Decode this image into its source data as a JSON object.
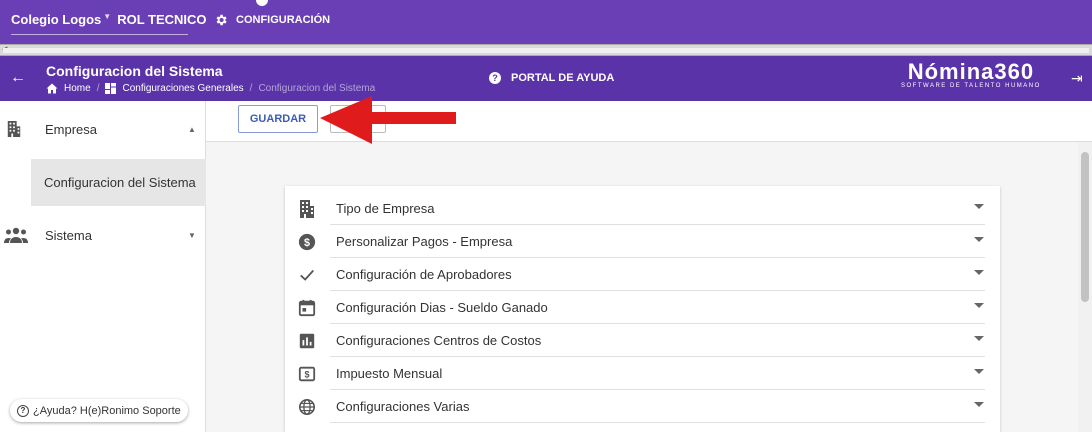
{
  "topbar": {
    "org_name": "Colegio Logos",
    "role": "ROL TECNICO",
    "config_label": "CONFIGURACIÓN"
  },
  "header": {
    "title": "Configuracion del Sistema",
    "breadcrumbs": [
      "Home",
      "Configuraciones Generales",
      "Configuracion del Sistema"
    ],
    "help_label": "PORTAL DE AYUDA",
    "brand_name": "Nómina360",
    "brand_tagline": "SOFTWARE DE TALENTO HUMANO"
  },
  "sidebar": {
    "items": [
      {
        "label": "Empresa",
        "icon": "building-icon",
        "chevron": "▲"
      },
      {
        "label": "Configuracion del Sistema"
      },
      {
        "label": "Sistema",
        "icon": "group-icon",
        "chevron": "▼"
      }
    ],
    "help_chip": "¿Ayuda? H(e)Ronimo Soporte"
  },
  "toolbar": {
    "save_label": "GUARDAR"
  },
  "sections": [
    {
      "label": "Tipo de Empresa",
      "icon": "building-icon"
    },
    {
      "label": "Personalizar Pagos - Empresa",
      "icon": "dollar-circle-icon"
    },
    {
      "label": "Configuración de Aprobadores",
      "icon": "check-icon"
    },
    {
      "label": "Configuración Dias - Sueldo Ganado",
      "icon": "calendar-icon"
    },
    {
      "label": "Configuraciones Centros de Costos",
      "icon": "bar-chart-icon"
    },
    {
      "label": "Impuesto Mensual",
      "icon": "dollar-box-icon"
    },
    {
      "label": "Configuraciones Varias",
      "icon": "globe-icon"
    }
  ],
  "colors": {
    "topbar": "#6a3fb5",
    "header": "#5a33a8",
    "accent": "#3b5bb7",
    "arrow": "#e01b1b"
  }
}
